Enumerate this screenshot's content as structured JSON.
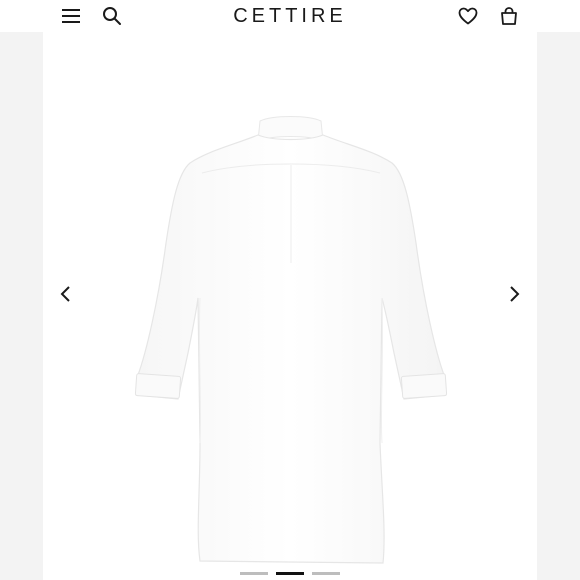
{
  "header": {
    "brand": "CETTIRE",
    "icons": [
      "menu-icon",
      "search-icon",
      "heart-icon",
      "shopping-bag-icon"
    ]
  },
  "gallery": {
    "product_image": "white-long-sleeve-shirt-back-view",
    "slides_total": 3,
    "active_slide": 2,
    "prev_icon": "chevron-left-icon",
    "next_icon": "chevron-right-icon"
  },
  "colors": {
    "brand_text": "#1a1a1a",
    "dot_active": "#111111",
    "dot_inactive": "#bdbdbd",
    "gutter": "#f3f3f3"
  }
}
